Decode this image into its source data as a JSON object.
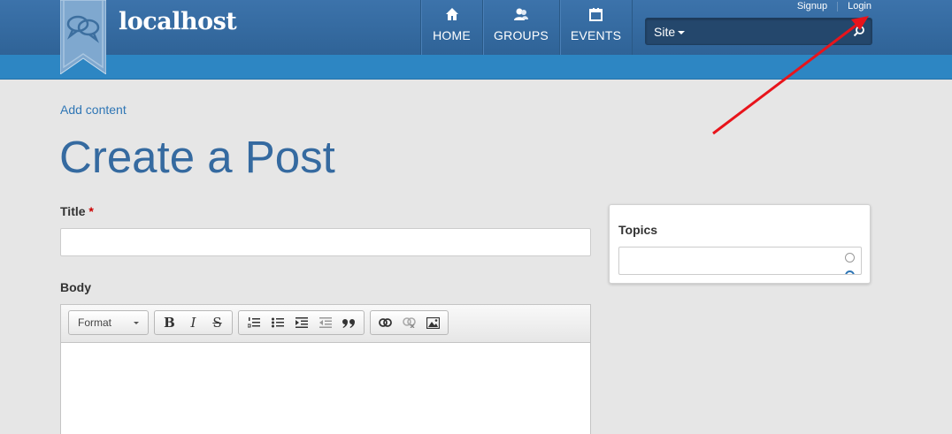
{
  "header": {
    "site_name": "localhost",
    "nav": [
      {
        "label": "HOME",
        "icon": "home-icon"
      },
      {
        "label": "GROUPS",
        "icon": "groups-icon"
      },
      {
        "label": "EVENTS",
        "icon": "calendar-icon"
      }
    ],
    "top_links": {
      "signup": "Signup",
      "login": "Login"
    },
    "search": {
      "scope": "Site",
      "placeholder": "",
      "icon": "search-icon"
    }
  },
  "main": {
    "breadcrumb": "Add content",
    "page_title": "Create a Post",
    "title_label": "Title",
    "title_required": "*",
    "title_value": "",
    "body_label": "Body",
    "editor": {
      "format_label": "Format",
      "buttons": [
        "B",
        "I",
        "S"
      ]
    }
  },
  "sidebar": {
    "topics_label": "Topics"
  },
  "colors": {
    "header": "#356aa0",
    "subbar": "#2d86c3",
    "link": "#2f76b5",
    "title": "#356aa0",
    "background": "#e6e6e6",
    "annotation_arrow": "#e8141b"
  }
}
